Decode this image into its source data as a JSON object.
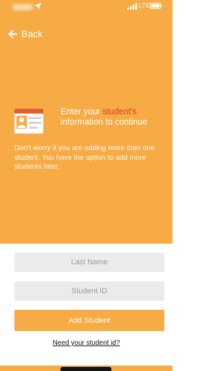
{
  "status_bar": {
    "network": "LTE",
    "icons": [
      "location-arrow-icon",
      "signal-bars-icon",
      "battery-icon"
    ]
  },
  "nav": {
    "back_label": "Back",
    "back_icon": "arrow-left-icon"
  },
  "info": {
    "icon": "id-card-icon",
    "headline_before": "Enter your ",
    "headline_highlight": "student's",
    "headline_after": "information to continue",
    "body": "Don't worry if you are adding more than one student. You have the option to add more students later."
  },
  "form": {
    "last_name_placeholder": "Last Name",
    "student_id_placeholder": "Student ID",
    "submit_label": "Add Student",
    "help_link": "Need your student id?"
  },
  "colors": {
    "primary": "#f6ab45",
    "highlight": "#e7372b",
    "field_bg": "#ebebeb"
  }
}
